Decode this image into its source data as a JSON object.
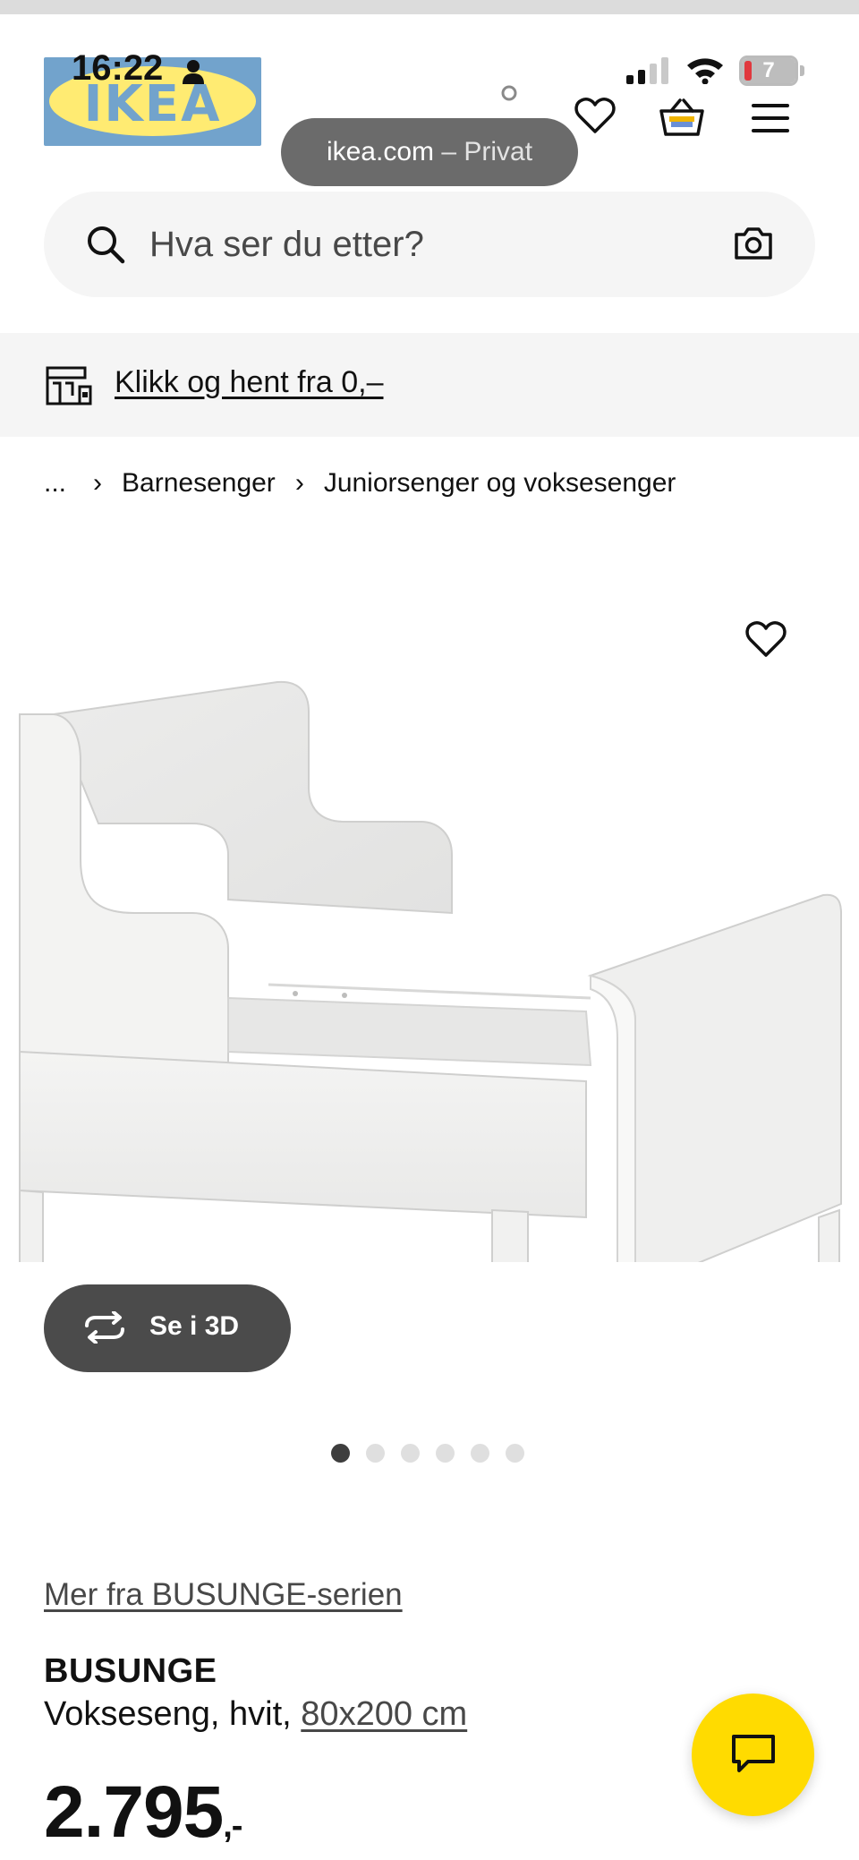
{
  "status_bar": {
    "time": "16:22",
    "battery": "7"
  },
  "header": {
    "logo_text": "IKEA",
    "url_pill": {
      "domain": "ikea.com",
      "mode": " – Privat"
    },
    "icons": [
      "account-icon",
      "heart-icon",
      "basket-icon",
      "menu-icon"
    ]
  },
  "search": {
    "placeholder": "Hva ser du etter?"
  },
  "promo": {
    "link_text": "Klikk og hent fra 0,–"
  },
  "breadcrumb": {
    "ellipsis": "...",
    "items": [
      "Barnesenger",
      "Juniorsenger og voksesenger"
    ]
  },
  "gallery": {
    "view_3d_label": "Se i 3D",
    "image_count": 6,
    "active_index": 0
  },
  "product": {
    "series_link": "Mer fra BUSUNGE-serien",
    "name": "BUSUNGE",
    "description": "Vokseseng, hvit,",
    "size": "80x200 cm",
    "price": "2.795",
    "price_suffix": ",-"
  },
  "colors": {
    "brand_blue": "#0058a3",
    "brand_yellow": "#ffdb00",
    "surface_gray": "#f5f5f5",
    "dark_button": "#4b4b4b"
  }
}
